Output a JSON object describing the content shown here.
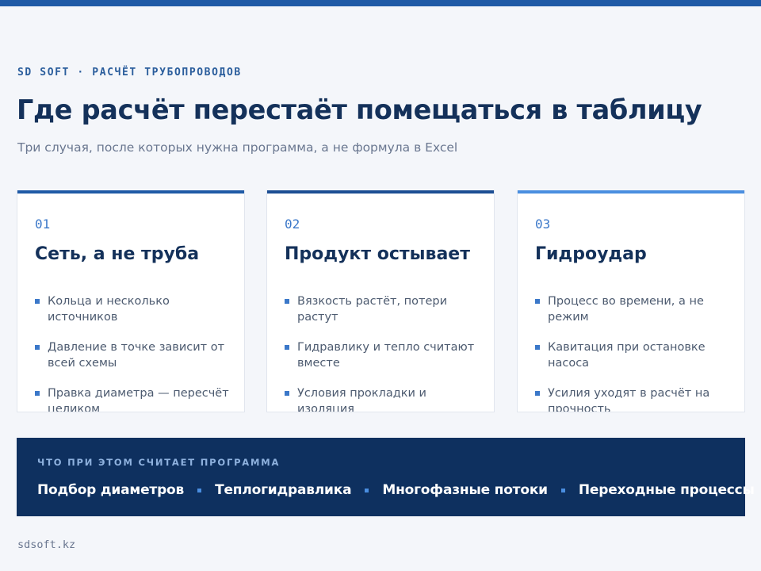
{
  "header": {
    "eyebrow": "SD SOFT · РАСЧЁТ ТРУБОПРОВОДОВ",
    "title": "Где расчёт перестаёт помещаться в таблицу",
    "subtitle": "Три случая, после которых нужна программа, а не формула в Excel"
  },
  "colors": {
    "top_bar": "#1f5aa6",
    "title": "#14315a",
    "accent": "#3b78c9",
    "banner_bg": "#0e305f",
    "card_accents": [
      "#1f5aa6",
      "#1c4e93",
      "#4a8ee0"
    ]
  },
  "cards": [
    {
      "number": "01",
      "title": "Сеть, а не труба",
      "items": [
        "Кольца и несколько источников",
        "Давление в точке зависит от всей схемы",
        "Правка диаметра — пересчёт целиком"
      ]
    },
    {
      "number": "02",
      "title": "Продукт остывает",
      "items": [
        "Вязкость растёт, потери растут",
        "Гидравлику и тепло считают вместе",
        "Условия прокладки и изоляция"
      ]
    },
    {
      "number": "03",
      "title": "Гидроудар",
      "items": [
        "Процесс во времени, а не режим",
        "Кавитация при остановке насоса",
        "Усилия уходят в расчёт на прочность"
      ]
    }
  ],
  "banner": {
    "label": "ЧТО ПРИ ЭТОМ СЧИТАЕТ ПРОГРАММА",
    "items": [
      "Подбор диаметров",
      "Теплогидравлика",
      "Многофазные потоки",
      "Переходные процессы"
    ]
  },
  "footer": {
    "site": "sdsoft.kz"
  }
}
